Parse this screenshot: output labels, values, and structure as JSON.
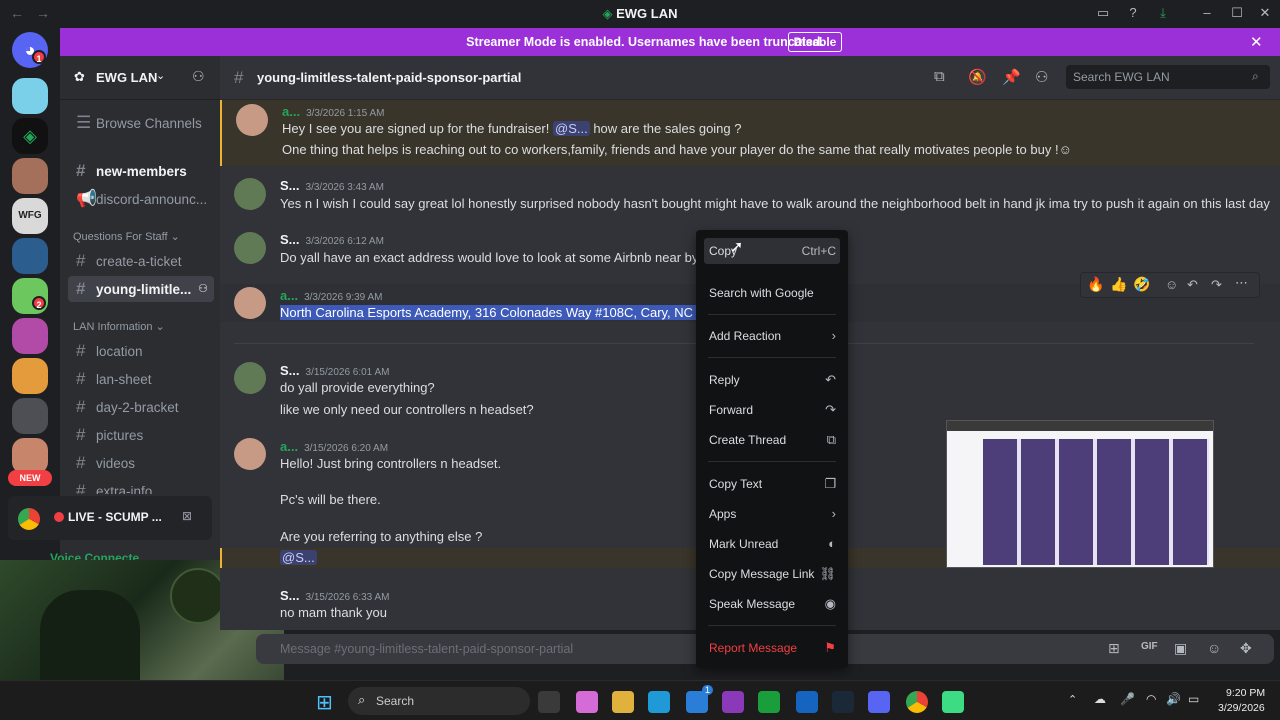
{
  "window": {
    "title": "EWG LAN"
  },
  "banner": {
    "text": "Streamer Mode is enabled. Usernames have been truncated.",
    "button": "Disable"
  },
  "guild": {
    "name": "EWG LAN"
  },
  "sidebar": {
    "browse": "Browse Channels",
    "channels_top": [
      "new-members",
      "discord-announc..."
    ],
    "cat1": "Questions For Staff",
    "cat1_channels": [
      "create-a-ticket",
      "young-limitle..."
    ],
    "cat2": "LAN Information",
    "cat2_channels": [
      "location",
      "lan-sheet",
      "day-2-bracket",
      "pictures",
      "videos",
      "extra-info"
    ],
    "live_text": "LIVE - SCUMP ...",
    "voice_text": "Voice Connecte...",
    "new_badge": "NEW"
  },
  "rail_badges": [
    "1",
    "2"
  ],
  "channel": {
    "name": "young-limitless-talent-paid-sponsor-partial",
    "search_placeholder": "Search EWG LAN"
  },
  "messages": [
    {
      "user": "a...",
      "ts": "3/3/2026 1:15 AM",
      "line1_a": "Hey I see you are signed up for the fundraiser!",
      "mention": "@S...",
      "line1_b": " how are the sales going ?",
      "line2": "One thing that helps is reaching out to co workers,family, friends and have your player do the same that really motivates  people to buy !"
    },
    {
      "user": "S...",
      "ts": "3/3/2026 3:43 AM",
      "line1": "Yes n I wish I could say great lol honestly surprised nobody hasn't bought might have to walk around the neighborhood belt in hand jk ima try to push it again on this last day"
    },
    {
      "user": "S...",
      "ts": "3/3/2026 6:12 AM",
      "line1": "Do yall have an exact address would love to look at some Airbnb near by"
    },
    {
      "user": "a...",
      "ts": "3/3/2026 9:39 AM",
      "line1": "North Carolina Esports Academy, 316 Colonades Way #108C, Cary, NC 275"
    },
    {
      "user": "S...",
      "ts": "3/15/2026 6:01 AM",
      "line1": "do yall provide everything?",
      "line2": "like we only need our controllers n headset?"
    },
    {
      "user": "a...",
      "ts": "3/15/2026 6:20 AM",
      "line1": "Hello! Just bring controllers n headset.",
      "line2": "Pc's will be there.",
      "line3": "Are you referring to anything else ?",
      "mention": "@S..."
    },
    {
      "user": "S...",
      "ts": "3/15/2026 6:33 AM",
      "line1": "no mam thank you"
    }
  ],
  "composer": {
    "placeholder": "Message #young-limitless-talent-paid-sponsor-partial"
  },
  "context_menu": {
    "copy": "Copy",
    "copy_shortcut": "Ctrl+C",
    "search_google": "Search with Google",
    "add_reaction": "Add Reaction",
    "reply": "Reply",
    "forward": "Forward",
    "create_thread": "Create Thread",
    "copy_text": "Copy Text",
    "apps": "Apps",
    "mark_unread": "Mark Unread",
    "copy_link": "Copy Message Link",
    "speak": "Speak Message",
    "report": "Report Message"
  },
  "taskbar": {
    "search": "Search",
    "time": "9:20 PM",
    "date": "3/29/2026",
    "badge": "1"
  },
  "colors": {
    "accent": "#9b30d9",
    "discord_bg": "#313338",
    "sidebar": "#2b2d31",
    "danger": "#f23f43",
    "mention_name": "#23a55a"
  }
}
